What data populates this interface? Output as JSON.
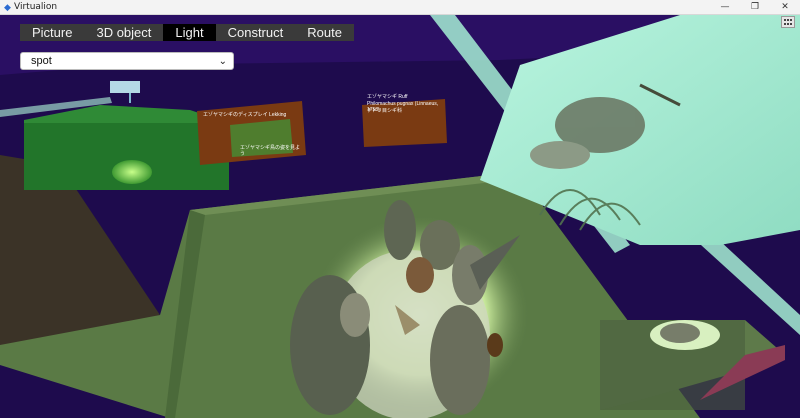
{
  "window": {
    "title": "Virtualion",
    "minimize": "—",
    "restore": "❐",
    "close": "✕"
  },
  "menu": {
    "tabs": [
      {
        "label": "Picture",
        "active": false
      },
      {
        "label": "3D object",
        "active": false
      },
      {
        "label": "Light",
        "active": true
      },
      {
        "label": "Construct",
        "active": false
      },
      {
        "label": "Route",
        "active": false
      }
    ]
  },
  "light_select": {
    "value": "spot",
    "options": [
      "spot"
    ]
  },
  "panels": {
    "left_panel_title": "エゾヤマシギのディスプレイ Lekking",
    "left_panel_caption": "エゾヤマシギ鳥の姿を見よう",
    "right_panel_title": "エゾヤマシギ  Ruff",
    "right_panel_sub": "Philomachus pugnax (Linnaeus, 1758)",
    "right_panel_sub2": "チドリ目シギ科"
  },
  "icons": {
    "app": "app-logo-icon",
    "grid": "grid-menu-icon",
    "dropdown": "chevron-down-icon"
  },
  "colors": {
    "background": "#1e0b4d",
    "floor": "#5a7a45",
    "wall_glass": "#a6efd5",
    "menu_active": "#000000",
    "menu_bg": "#3a3a3a"
  }
}
